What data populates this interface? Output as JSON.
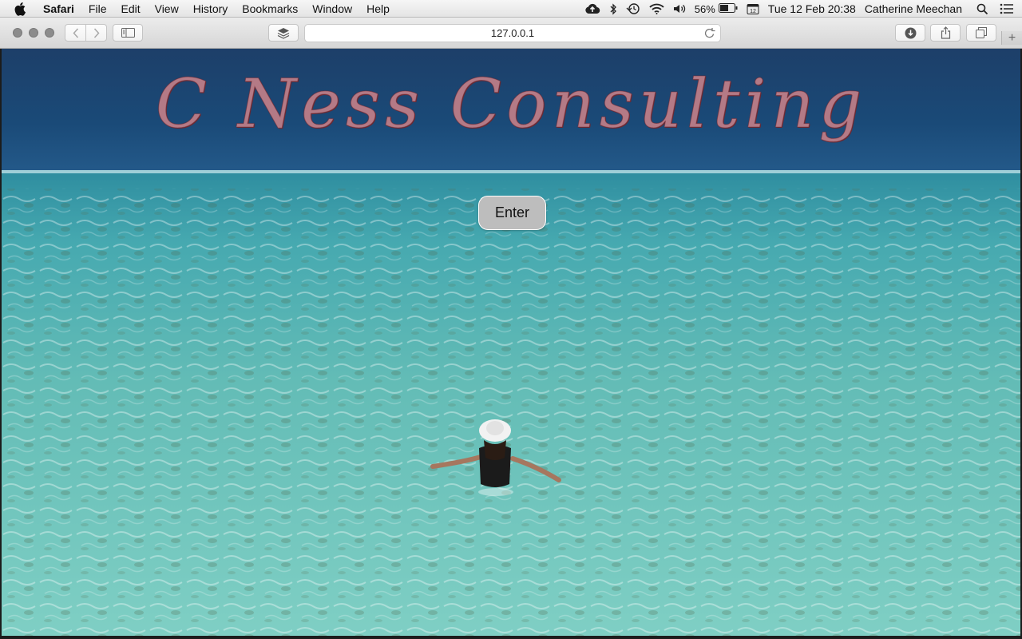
{
  "menubar": {
    "app_name": "Safari",
    "items": [
      "File",
      "Edit",
      "View",
      "History",
      "Bookmarks",
      "Window",
      "Help"
    ],
    "battery_percent": "56%",
    "datetime": "Tue 12 Feb  20:38",
    "user_name": "Catherine Meechan",
    "status_icons": [
      "cloud-upload-icon",
      "bluetooth-icon",
      "time-machine-icon",
      "wifi-icon",
      "volume-icon",
      "battery-icon",
      "calendar-icon",
      "spotlight-search-icon",
      "notification-center-icon"
    ]
  },
  "browser": {
    "url": "127.0.0.1",
    "new_tab_label": "+",
    "toolbar_icons": [
      "back-icon",
      "forward-icon",
      "sidebar-icon",
      "layers-icon",
      "reload-icon",
      "download-icon",
      "share-icon",
      "tabs-overview-icon"
    ]
  },
  "page": {
    "title": "C Ness Consulting",
    "enter_label": "Enter",
    "colors": {
      "title": "#b47a86",
      "button_bg": "#bdbdbd",
      "sky": "#1b3f6b",
      "water": "#5ab9b6"
    }
  }
}
